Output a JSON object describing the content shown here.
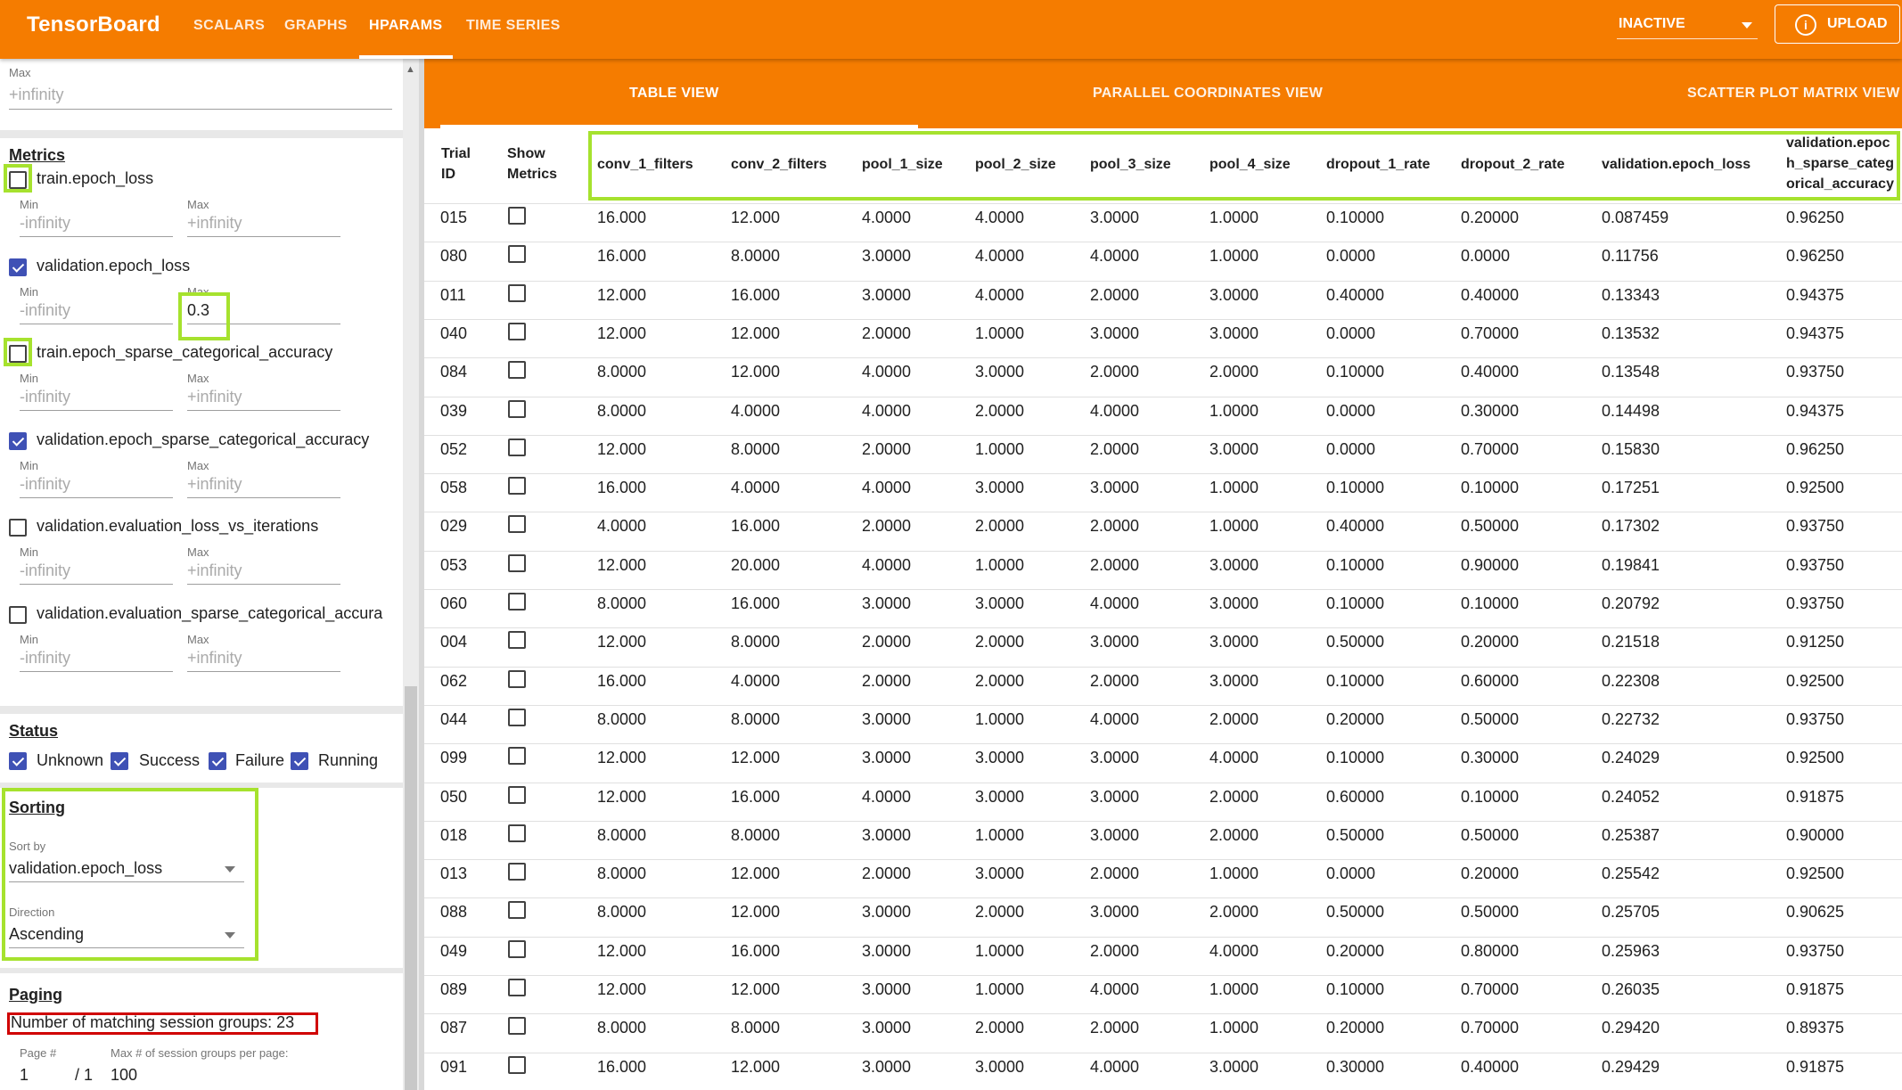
{
  "app": {
    "brand": "TensorBoard",
    "nav_tabs": [
      "SCALARS",
      "GRAPHS",
      "HPARAMS",
      "TIME SERIES"
    ],
    "active_tab": "HPARAMS",
    "run_select": "INACTIVE",
    "upload_label": "UPLOAD",
    "accent_color": "#f57c00"
  },
  "sidebar": {
    "top_field": {
      "label": "Max",
      "value": "+infinity"
    },
    "metrics": {
      "title": "Metrics",
      "items": [
        {
          "label": "train.epoch_loss",
          "checked": false,
          "min_label": "Min",
          "min": "-infinity",
          "max_label": "Max",
          "max": "+infinity"
        },
        {
          "label": "validation.epoch_loss",
          "checked": true,
          "min_label": "Min",
          "min": "-infinity",
          "max_label": "Max",
          "max": "0.3"
        },
        {
          "label": "train.epoch_sparse_categorical_accuracy",
          "checked": false,
          "min_label": "Min",
          "min": "-infinity",
          "max_label": "Max",
          "max": "+infinity"
        },
        {
          "label": "validation.epoch_sparse_categorical_accuracy",
          "checked": true,
          "min_label": "Min",
          "min": "-infinity",
          "max_label": "Max",
          "max": "+infinity"
        },
        {
          "label": "validation.evaluation_loss_vs_iterations",
          "checked": false,
          "min_label": "Min",
          "min": "-infinity",
          "max_label": "Max",
          "max": "+infinity"
        },
        {
          "label": "validation.evaluation_sparse_categorical_accura",
          "checked": false,
          "min_label": "Min",
          "min": "-infinity",
          "max_label": "Max",
          "max": "+infinity"
        }
      ]
    },
    "status": {
      "title": "Status",
      "items": [
        {
          "label": "Unknown",
          "checked": true
        },
        {
          "label": "Success",
          "checked": true
        },
        {
          "label": "Failure",
          "checked": true
        },
        {
          "label": "Running",
          "checked": true
        }
      ]
    },
    "sorting": {
      "title": "Sorting",
      "sort_by_label": "Sort by",
      "sort_by": "validation.epoch_loss",
      "direction_label": "Direction",
      "direction": "Ascending"
    },
    "paging": {
      "title": "Paging",
      "matching_text": "Number of matching session groups: 23",
      "page_label": "Page #",
      "page": "1",
      "page_total": "/ 1",
      "per_page_label": "Max # of session groups per page:",
      "per_page": "100"
    }
  },
  "view_tabs": [
    "TABLE VIEW",
    "PARALLEL COORDINATES VIEW",
    "SCATTER PLOT MATRIX VIEW"
  ],
  "active_view": "TABLE VIEW",
  "table": {
    "headers": {
      "trial_id": [
        "Trial",
        "ID"
      ],
      "show_metrics": [
        "Show",
        "Metrics"
      ],
      "columns": [
        "conv_1_filters",
        "conv_2_filters",
        "pool_1_size",
        "pool_2_size",
        "pool_3_size",
        "pool_4_size",
        "dropout_1_rate",
        "dropout_2_rate",
        "validation.epoch_loss"
      ],
      "last_column": [
        "validation.epoc",
        "h_sparse_categ",
        "orical_accuracy"
      ]
    },
    "rows": [
      [
        "015",
        "16.000",
        "12.000",
        "4.0000",
        "4.0000",
        "3.0000",
        "1.0000",
        "0.10000",
        "0.20000",
        "0.087459",
        "0.96250"
      ],
      [
        "080",
        "16.000",
        "8.0000",
        "3.0000",
        "4.0000",
        "4.0000",
        "1.0000",
        "0.0000",
        "0.0000",
        "0.11756",
        "0.96250"
      ],
      [
        "011",
        "12.000",
        "16.000",
        "3.0000",
        "4.0000",
        "2.0000",
        "3.0000",
        "0.40000",
        "0.40000",
        "0.13343",
        "0.94375"
      ],
      [
        "040",
        "12.000",
        "12.000",
        "2.0000",
        "1.0000",
        "3.0000",
        "3.0000",
        "0.0000",
        "0.70000",
        "0.13532",
        "0.94375"
      ],
      [
        "084",
        "8.0000",
        "12.000",
        "4.0000",
        "3.0000",
        "2.0000",
        "2.0000",
        "0.10000",
        "0.40000",
        "0.13548",
        "0.93750"
      ],
      [
        "039",
        "8.0000",
        "4.0000",
        "4.0000",
        "2.0000",
        "4.0000",
        "1.0000",
        "0.0000",
        "0.30000",
        "0.14498",
        "0.94375"
      ],
      [
        "052",
        "12.000",
        "8.0000",
        "2.0000",
        "1.0000",
        "2.0000",
        "3.0000",
        "0.0000",
        "0.70000",
        "0.15830",
        "0.96250"
      ],
      [
        "058",
        "16.000",
        "4.0000",
        "4.0000",
        "3.0000",
        "3.0000",
        "1.0000",
        "0.10000",
        "0.10000",
        "0.17251",
        "0.92500"
      ],
      [
        "029",
        "4.0000",
        "16.000",
        "2.0000",
        "2.0000",
        "2.0000",
        "1.0000",
        "0.40000",
        "0.50000",
        "0.17302",
        "0.93750"
      ],
      [
        "053",
        "12.000",
        "20.000",
        "4.0000",
        "1.0000",
        "2.0000",
        "3.0000",
        "0.10000",
        "0.90000",
        "0.19841",
        "0.93750"
      ],
      [
        "060",
        "8.0000",
        "16.000",
        "3.0000",
        "3.0000",
        "4.0000",
        "3.0000",
        "0.10000",
        "0.10000",
        "0.20792",
        "0.93750"
      ],
      [
        "004",
        "12.000",
        "8.0000",
        "2.0000",
        "2.0000",
        "3.0000",
        "3.0000",
        "0.50000",
        "0.20000",
        "0.21518",
        "0.91250"
      ],
      [
        "062",
        "16.000",
        "4.0000",
        "2.0000",
        "2.0000",
        "2.0000",
        "3.0000",
        "0.10000",
        "0.60000",
        "0.22308",
        "0.92500"
      ],
      [
        "044",
        "8.0000",
        "8.0000",
        "3.0000",
        "1.0000",
        "4.0000",
        "2.0000",
        "0.20000",
        "0.50000",
        "0.22732",
        "0.93750"
      ],
      [
        "099",
        "12.000",
        "12.000",
        "3.0000",
        "3.0000",
        "3.0000",
        "4.0000",
        "0.10000",
        "0.30000",
        "0.24029",
        "0.92500"
      ],
      [
        "050",
        "12.000",
        "16.000",
        "4.0000",
        "3.0000",
        "3.0000",
        "2.0000",
        "0.60000",
        "0.10000",
        "0.24052",
        "0.91875"
      ],
      [
        "018",
        "8.0000",
        "8.0000",
        "3.0000",
        "1.0000",
        "3.0000",
        "2.0000",
        "0.50000",
        "0.50000",
        "0.25387",
        "0.90000"
      ],
      [
        "013",
        "8.0000",
        "12.000",
        "2.0000",
        "3.0000",
        "2.0000",
        "1.0000",
        "0.0000",
        "0.20000",
        "0.25542",
        "0.92500"
      ],
      [
        "088",
        "8.0000",
        "12.000",
        "3.0000",
        "2.0000",
        "3.0000",
        "2.0000",
        "0.50000",
        "0.50000",
        "0.25705",
        "0.90625"
      ],
      [
        "049",
        "12.000",
        "16.000",
        "3.0000",
        "1.0000",
        "2.0000",
        "4.0000",
        "0.20000",
        "0.80000",
        "0.25963",
        "0.93750"
      ],
      [
        "089",
        "12.000",
        "12.000",
        "3.0000",
        "1.0000",
        "4.0000",
        "1.0000",
        "0.10000",
        "0.70000",
        "0.26035",
        "0.91875"
      ],
      [
        "087",
        "8.0000",
        "8.0000",
        "3.0000",
        "2.0000",
        "2.0000",
        "1.0000",
        "0.20000",
        "0.70000",
        "0.29420",
        "0.89375"
      ],
      [
        "091",
        "16.000",
        "12.000",
        "3.0000",
        "3.0000",
        "4.0000",
        "3.0000",
        "0.30000",
        "0.40000",
        "0.29429",
        "0.91875"
      ]
    ]
  },
  "highlight_colors": {
    "green": "#a6e22e",
    "red": "#d00000"
  }
}
